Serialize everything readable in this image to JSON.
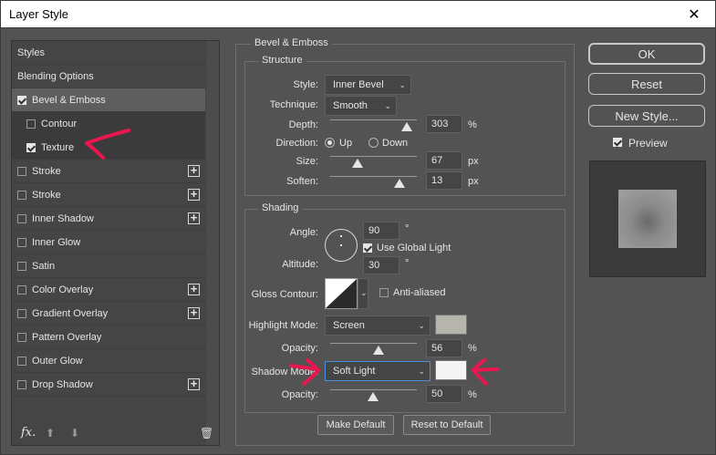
{
  "window": {
    "title": "Layer Style",
    "close_glyph": "✕"
  },
  "left_panel": {
    "items": [
      {
        "label": "Styles",
        "checkbox": false,
        "checked": false,
        "plus": false
      },
      {
        "label": "Blending Options",
        "checkbox": false,
        "checked": false,
        "plus": false
      },
      {
        "label": "Bevel & Emboss",
        "checkbox": true,
        "checked": true,
        "plus": false
      },
      {
        "label": "Contour",
        "checkbox": true,
        "checked": false,
        "plus": false
      },
      {
        "label": "Texture",
        "checkbox": true,
        "checked": true,
        "plus": false
      },
      {
        "label": "Stroke",
        "checkbox": true,
        "checked": false,
        "plus": true
      },
      {
        "label": "Stroke",
        "checkbox": true,
        "checked": false,
        "plus": true
      },
      {
        "label": "Inner Shadow",
        "checkbox": true,
        "checked": false,
        "plus": true
      },
      {
        "label": "Inner Glow",
        "checkbox": true,
        "checked": false,
        "plus": false
      },
      {
        "label": "Satin",
        "checkbox": true,
        "checked": false,
        "plus": false
      },
      {
        "label": "Color Overlay",
        "checkbox": true,
        "checked": false,
        "plus": true
      },
      {
        "label": "Gradient Overlay",
        "checkbox": true,
        "checked": false,
        "plus": true
      },
      {
        "label": "Pattern Overlay",
        "checkbox": true,
        "checked": false,
        "plus": false
      },
      {
        "label": "Outer Glow",
        "checkbox": true,
        "checked": false,
        "plus": false
      },
      {
        "label": "Drop Shadow",
        "checkbox": true,
        "checked": false,
        "plus": true
      }
    ],
    "footer": {
      "fx": "fx",
      "fx_sub": ".",
      "up_glyph": "⬆",
      "down_glyph": "⬇",
      "trash_glyph": "🗑"
    },
    "plus_glyph": "+"
  },
  "bevel_emboss": {
    "group_title": "Bevel & Emboss",
    "structure": {
      "title": "Structure",
      "style_label": "Style:",
      "style_value": "Inner Bevel",
      "technique_label": "Technique:",
      "technique_value": "Smooth",
      "depth_label": "Depth:",
      "depth_value": "303",
      "depth_unit": "%",
      "direction_label": "Direction:",
      "direction_up": "Up",
      "direction_down": "Down",
      "direction_selected": "Up",
      "size_label": "Size:",
      "size_value": "67",
      "size_unit": "px",
      "soften_label": "Soften:",
      "soften_value": "13",
      "soften_unit": "px"
    },
    "shading": {
      "title": "Shading",
      "angle_label": "Angle:",
      "angle_value": "90",
      "angle_unit": "°",
      "global_light_label": "Use Global Light",
      "global_light_checked": true,
      "altitude_label": "Altitude:",
      "altitude_value": "30",
      "altitude_unit": "°",
      "gloss_contour_label": "Gloss Contour:",
      "anti_aliased_label": "Anti-aliased",
      "anti_aliased_checked": false,
      "highlight_mode_label": "Highlight Mode:",
      "highlight_mode_value": "Screen",
      "highlight_color": "#b5b5ae",
      "highlight_opacity_label": "Opacity:",
      "highlight_opacity_value": "56",
      "highlight_opacity_unit": "%",
      "shadow_mode_label": "Shadow Mode:",
      "shadow_mode_value": "Soft Light",
      "shadow_color": "#f5f5f5",
      "shadow_opacity_label": "Opacity:",
      "shadow_opacity_value": "50",
      "shadow_opacity_unit": "%"
    },
    "make_default": "Make Default",
    "reset_to_default": "Reset to Default"
  },
  "right": {
    "ok": "OK",
    "reset": "Reset",
    "new_style": "New Style...",
    "preview_label": "Preview",
    "preview_checked": true
  },
  "colors": {
    "annotation": "#e8174f",
    "panel": "#535353",
    "field": "#454545"
  },
  "chevron_glyph": "⌄"
}
